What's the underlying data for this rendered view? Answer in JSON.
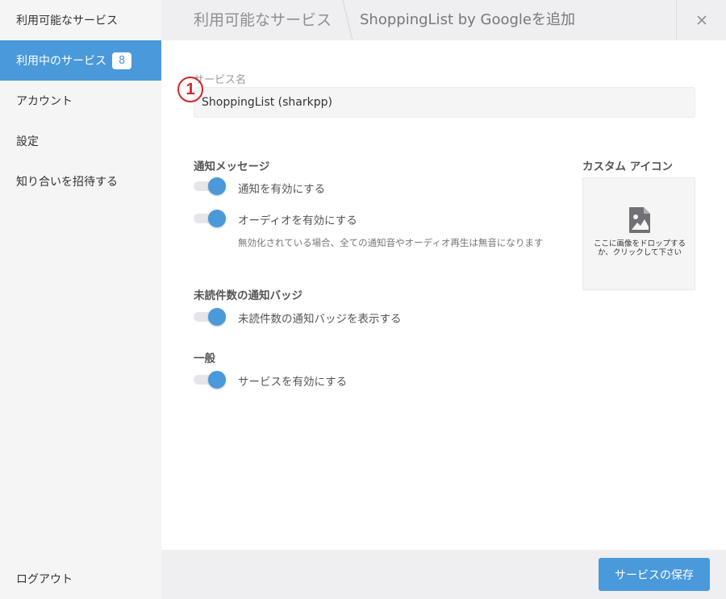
{
  "sidebar": {
    "items": [
      {
        "label": "利用可能なサービス"
      },
      {
        "label": "利用中のサービス",
        "badge": "8"
      },
      {
        "label": "アカウント"
      },
      {
        "label": "設定"
      },
      {
        "label": "知り合いを招待する"
      }
    ],
    "logout_label": "ログアウト"
  },
  "header": {
    "breadcrumb_parent": "利用可能なサービス",
    "title": "ShoppingList by Googleを追加",
    "close_icon": "close-icon"
  },
  "form": {
    "service_name_label": "サービス名",
    "service_name_value": "ShoppingList (sharkpp)",
    "annotation_marker": "1",
    "notifications": {
      "title": "通知メッセージ",
      "enable_notifications": "通知を有効にする",
      "enable_audio": "オーディオを有効にする",
      "hint": "無効化されている場合、全ての通知音やオーディオ再生は無音になります"
    },
    "unread_badge": {
      "title": "未読件数の通知バッジ",
      "show_badge": "未読件数の通知バッジを表示する"
    },
    "general": {
      "title": "一般",
      "enable_service": "サービスを有効にする"
    },
    "custom_icon": {
      "title": "カスタム アイコン",
      "drop_text": "ここに画像をドロップするか、クリックして下さい",
      "icon": "image-icon"
    }
  },
  "footer": {
    "save_label": "サービスの保存"
  },
  "colors": {
    "accent": "#4a99da",
    "sidebar_bg": "#f5f5f6",
    "header_bg": "#efeff1",
    "annotation": "#d8232a"
  },
  "toggles": {
    "enable_notifications": true,
    "enable_audio": true,
    "show_badge": true,
    "enable_service": true
  }
}
